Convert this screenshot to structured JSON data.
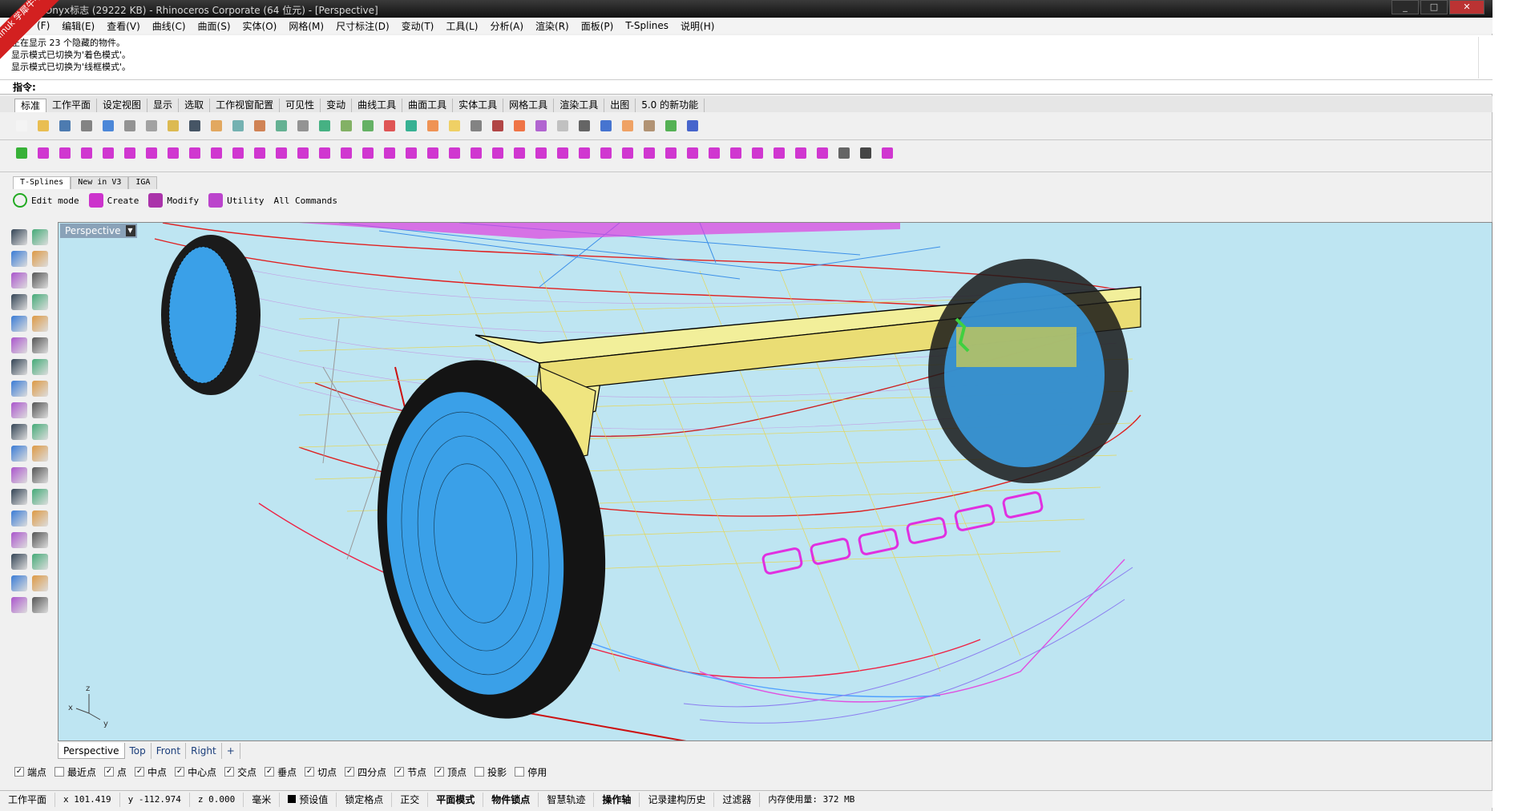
{
  "window": {
    "title": "ot Onyx标志 (29222 KB) - Rhinoceros Corporate (64 位元) - [Perspective]",
    "watermark": "xuelinuk 学犀牛中文网",
    "controls": [
      "_",
      "□",
      "✕"
    ]
  },
  "menu": [
    "(F)",
    "编辑(E)",
    "查看(V)",
    "曲线(C)",
    "曲面(S)",
    "实体(O)",
    "网格(M)",
    "尺寸标注(D)",
    "变动(T)",
    "工具(L)",
    "分析(A)",
    "渲染(R)",
    "面板(P)",
    "T-Splines",
    "说明(H)"
  ],
  "command_history": [
    "正在显示 23 个隐藏的物件。",
    "显示模式已切换为'着色模式'。",
    "显示模式已切换为'线框模式'。"
  ],
  "command_prompt": "指令:",
  "toolbar_tabs": [
    "标准",
    "工作平面",
    "设定视图",
    "显示",
    "选取",
    "工作视窗配置",
    "可见性",
    "变动",
    "曲线工具",
    "曲面工具",
    "实体工具",
    "网格工具",
    "渲染工具",
    "出图",
    "5.0 的新功能"
  ],
  "active_toolbar_tab": "标准",
  "standard_icons": [
    "new-icon",
    "open-icon",
    "save-icon",
    "print-icon",
    "import-icon",
    "cut-icon",
    "copy-icon",
    "paste-icon",
    "undo-icon",
    "pan-icon",
    "rotate-view-icon",
    "zoom-dynamic-icon",
    "zoom-window-icon",
    "zoom-extents-icon",
    "zoom-selected-icon",
    "undo-view-icon",
    "four-view-icon",
    "cplane-icon",
    "shade-icon",
    "rendered-icon",
    "select-icon",
    "light-icon",
    "lock-icon",
    "layer-icon",
    "color-icon",
    "material-icon",
    "render-icon",
    "sphere-icon",
    "filter-icon",
    "options-icon",
    "grips-icon",
    "help-icon"
  ],
  "standard_icon_colors": [
    "#f4f4f4",
    "#e8b840",
    "#3b6ea8",
    "#777",
    "#3a7bd5",
    "#888",
    "#999",
    "#d9b440",
    "#345",
    "#e0a050",
    "#6aa",
    "#c74",
    "#5a8",
    "#888",
    "#3a7",
    "#7a5",
    "#5a5",
    "#d44",
    "#2a8",
    "#e84",
    "#ec5",
    "#777",
    "#a33",
    "#e63",
    "#a5c",
    "#bbb",
    "#555",
    "#3366cc",
    "#e95",
    "#a86",
    "#4a4",
    "#3455c8"
  ],
  "tsplines_icons": [
    "edit-mode-icon",
    "box-icon",
    "cylinder-icon",
    "cone-icon",
    "plane-icon",
    "torus-icon",
    "quadball-icon",
    "circle-icon",
    "face-icon",
    "extrude-icon",
    "append-icon",
    "crease-icon",
    "weld-icon",
    "unweld-icon",
    "bridge-icon",
    "fill-hole-icon",
    "insert-edge-icon",
    "insert-point-icon",
    "delete-icon",
    "split-icon",
    "merge-icon",
    "subdivide-icon",
    "smooth-icon",
    "match-icon",
    "pull-icon",
    "symmetry-icon",
    "convert-icon",
    "thicken-icon",
    "loft-icon",
    "pipe-icon",
    "rebuild-icon",
    "select-icon",
    "grow-icon",
    "shrink-icon",
    "ring-icon",
    "loop-icon",
    "hide-icon",
    "show-icon",
    "info-icon",
    "manip-icon",
    "utility-icon"
  ],
  "tsplines_icon_colors": [
    "#2a2",
    "#c2c",
    "#c2c",
    "#c2c",
    "#c2c",
    "#c2c",
    "#c2c",
    "#c2c",
    "#c2c",
    "#c2c",
    "#c2c",
    "#c2c",
    "#c2c",
    "#c2c",
    "#c2c",
    "#c2c",
    "#c2c",
    "#c2c",
    "#c2c",
    "#c2c",
    "#c2c",
    "#c2c",
    "#c2c",
    "#c2c",
    "#c2c",
    "#c2c",
    "#c2c",
    "#c2c",
    "#c2c",
    "#c2c",
    "#c2c",
    "#c2c",
    "#c2c",
    "#c2c",
    "#c2c",
    "#c2c",
    "#c2c",
    "#c2c",
    "#555",
    "#333",
    "#c2c"
  ],
  "tsplines_tabs": [
    "T-Splines",
    "New in V3",
    "IGA"
  ],
  "tsplines_buttons": [
    "Edit mode",
    "Create",
    "Modify",
    "Utility",
    "All Commands"
  ],
  "left_tools": [
    "select-arrow-icon",
    "point-icon",
    "polyline-icon",
    "curve-icon",
    "circle-icon",
    "rectangle-icon",
    "polygon-icon",
    "arc-icon",
    "ellipse-icon",
    "fillet-icon",
    "surface-icon",
    "sweep-icon",
    "box-icon",
    "sphere-icon",
    "extrude-icon",
    "loft-icon",
    "boolean-icon",
    "explode-icon",
    "move-icon",
    "rotate-icon",
    "scale-icon",
    "mirror-icon",
    "trim-icon",
    "split-icon",
    "text-icon",
    "dimension-icon",
    "group-icon",
    "block-icon",
    "layer-icon",
    "properties-icon",
    "array-icon",
    "orient-icon",
    "analyze-icon",
    "check-icon",
    "render-icon",
    "light-icon"
  ],
  "viewport": {
    "label": "Perspective",
    "background": "#bee5f2",
    "axis_labels": [
      "z",
      "x",
      "y"
    ]
  },
  "view_tabs": [
    "Perspective",
    "Top",
    "Front",
    "Right",
    "+"
  ],
  "active_view": "Perspective",
  "osnaps": [
    {
      "label": "端点",
      "checked": true
    },
    {
      "label": "最近点",
      "checked": false
    },
    {
      "label": "点",
      "checked": true
    },
    {
      "label": "中点",
      "checked": true
    },
    {
      "label": "中心点",
      "checked": true
    },
    {
      "label": "交点",
      "checked": true
    },
    {
      "label": "垂点",
      "checked": true
    },
    {
      "label": "切点",
      "checked": true
    },
    {
      "label": "四分点",
      "checked": true
    },
    {
      "label": "节点",
      "checked": true
    },
    {
      "label": "顶点",
      "checked": true
    },
    {
      "label": "投影",
      "checked": false
    },
    {
      "label": "停用",
      "checked": false
    }
  ],
  "status": {
    "cplane": "工作平面",
    "x": "x 101.419",
    "y": "y -112.974",
    "z": "z 0.000",
    "unit": "毫米",
    "layer": "预设值",
    "toggles": [
      "锁定格点",
      "正交",
      "平面模式",
      "物件锁点",
      "智慧轨迹",
      "操作轴",
      "记录建构历史",
      "过滤器"
    ],
    "bold_toggles": [
      "平面模式",
      "物件锁点",
      "操作轴"
    ],
    "memory": "内存使用量: 372 MB"
  }
}
